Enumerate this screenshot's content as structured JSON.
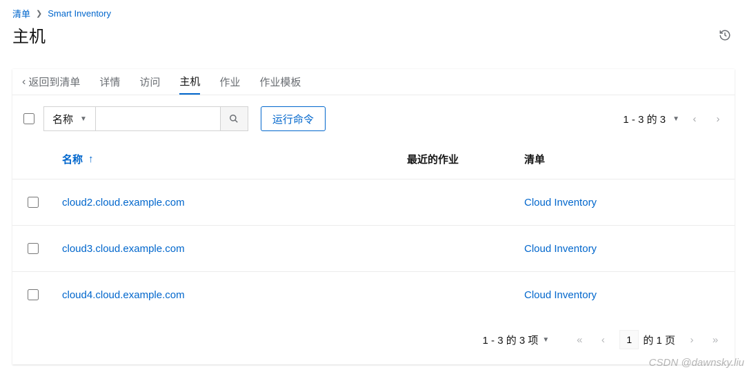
{
  "breadcrumb": {
    "root": "清单",
    "current": "Smart Inventory"
  },
  "page_title": "主机",
  "tabs": {
    "back": "返回到清单",
    "items": [
      "详情",
      "访问",
      "主机",
      "作业",
      "作业模板"
    ],
    "active_index": 2
  },
  "toolbar": {
    "filter_field": "名称",
    "search_value": "",
    "run_command": "运行命令"
  },
  "top_pager": {
    "summary": "1 - 3 的 3"
  },
  "columns": {
    "name": "名称",
    "recent_jobs": "最近的作业",
    "inventory": "清单"
  },
  "rows": [
    {
      "name": "cloud2.cloud.example.com",
      "recent": "",
      "inventory": "Cloud Inventory"
    },
    {
      "name": "cloud3.cloud.example.com",
      "recent": "",
      "inventory": "Cloud Inventory"
    },
    {
      "name": "cloud4.cloud.example.com",
      "recent": "",
      "inventory": "Cloud Inventory"
    }
  ],
  "footer": {
    "summary": "1 - 3 的 3 项",
    "page_value": "1",
    "page_total_label": "的 1 页"
  },
  "watermark": "CSDN @dawnsky.liu"
}
